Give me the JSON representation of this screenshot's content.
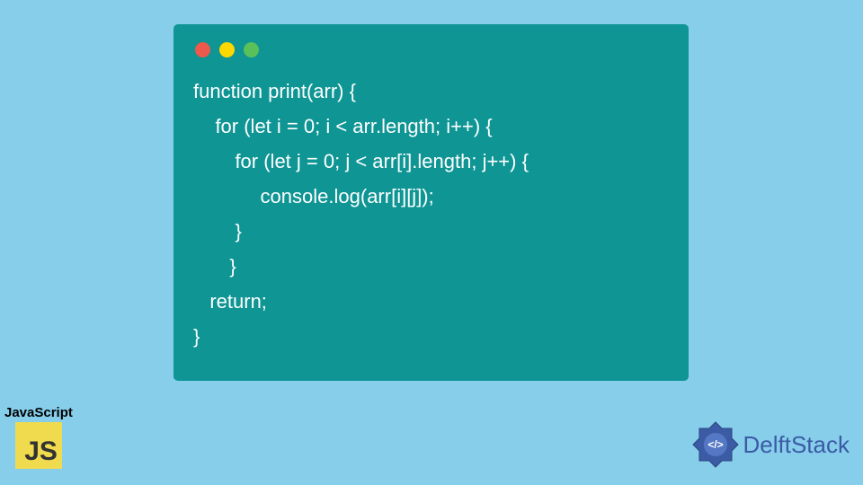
{
  "code": {
    "lines": [
      "function print(arr) {",
      "    for (let i = 0; i < arr.length; i++) {",
      "     for (let j = 0; j < arr[i].length; j++) {",
      "       console.log(arr[i][j]);",
      "     }",
      "    }",
      "   return;",
      "}"
    ]
  },
  "badges": {
    "js_label": "JavaScript",
    "js_icon_text": "JS",
    "delftstack_text": "DelftStack"
  },
  "colors": {
    "background": "#87CEEB",
    "code_bg": "#0E9594",
    "code_text": "#FFFFFF",
    "dot_red": "#ED594A",
    "dot_yellow": "#FDD800",
    "dot_green": "#5AC05A",
    "js_bg": "#F0DB4F",
    "ds_accent": "#3B5BA5"
  }
}
